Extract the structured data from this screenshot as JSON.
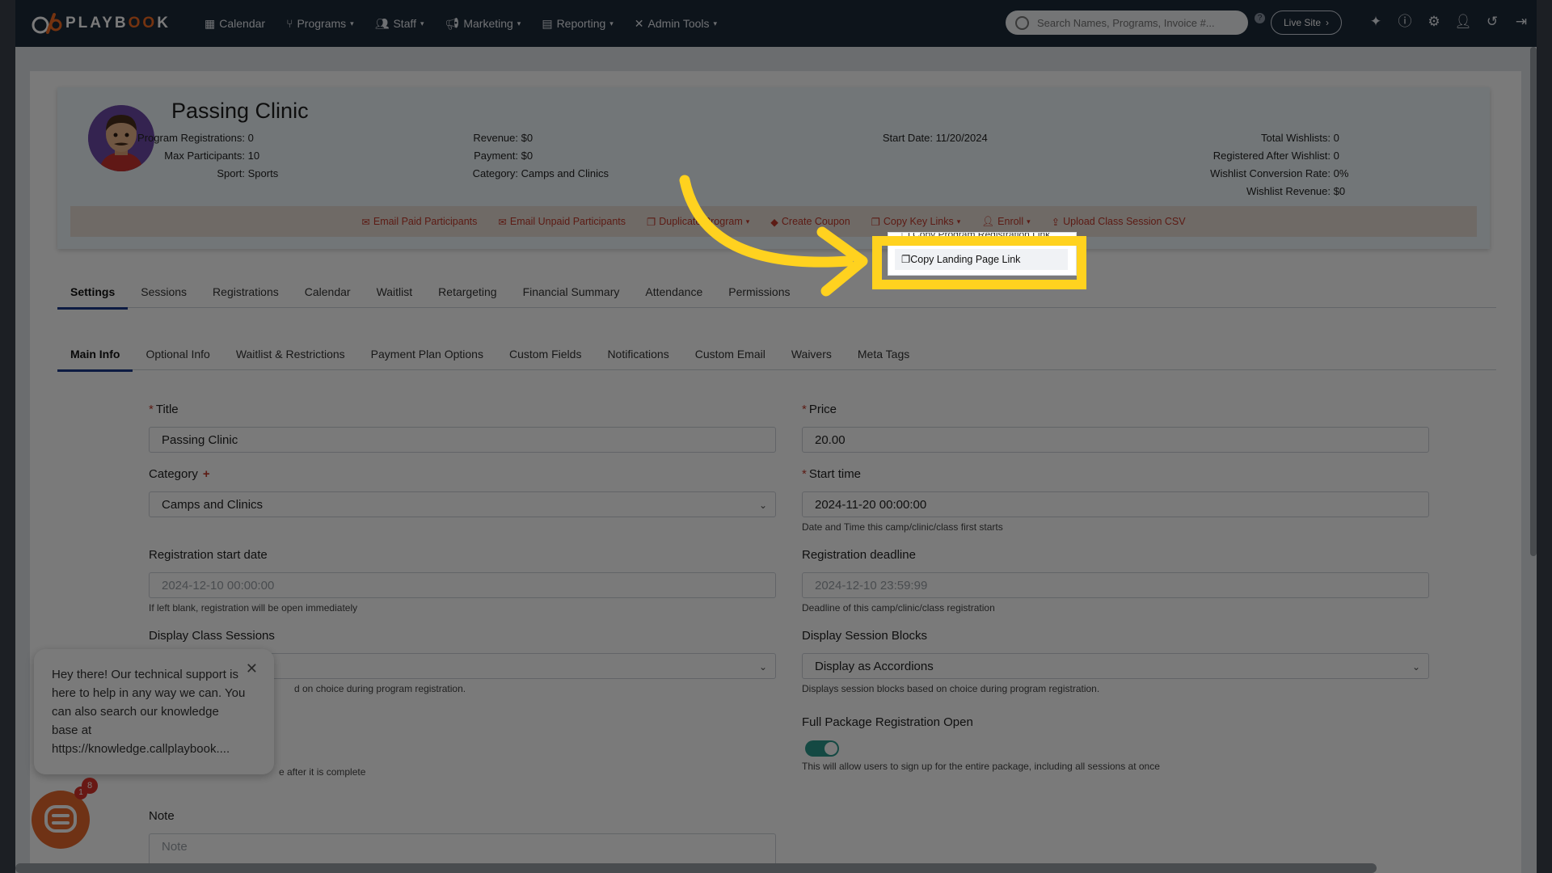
{
  "nav": {
    "brand": "PLAYBOOK",
    "items": [
      {
        "label": "Calendar",
        "icon": "calendar-icon",
        "caret": false
      },
      {
        "label": "Programs",
        "icon": "programs-icon",
        "caret": true
      },
      {
        "label": "Staff",
        "icon": "staff-icon",
        "caret": true
      },
      {
        "label": "Marketing",
        "icon": "megaphone-icon",
        "caret": true
      },
      {
        "label": "Reporting",
        "icon": "report-icon",
        "caret": true
      },
      {
        "label": "Admin Tools",
        "icon": "tools-icon",
        "caret": true
      }
    ],
    "search_placeholder": "Search Names, Programs, Invoice #...",
    "live_site": "Live Site"
  },
  "program": {
    "title": "Passing Clinic",
    "stats": {
      "program_registrations": {
        "label": "Program Registrations:",
        "value": "0"
      },
      "max_participants": {
        "label": "Max Participants:",
        "value": "10"
      },
      "sport": {
        "label": "Sport:",
        "value": "Sports"
      },
      "revenue": {
        "label": "Revenue:",
        "value": "$0"
      },
      "payment": {
        "label": "Payment:",
        "value": "$0"
      },
      "category": {
        "label": "Category:",
        "value": "Camps and Clinics"
      },
      "start_date": {
        "label": "Start Date:",
        "value": "11/20/2024"
      },
      "total_wishlists": {
        "label": "Total Wishlists:",
        "value": "0"
      },
      "registered_after_wishlist": {
        "label": "Registered After Wishlist:",
        "value": "0"
      },
      "wishlist_conversion_rate": {
        "label": "Wishlist Conversion Rate:",
        "value": "0%"
      },
      "wishlist_revenue": {
        "label": "Wishlist Revenue:",
        "value": "$0"
      }
    },
    "actions": {
      "email_paid": "Email Paid Participants",
      "email_unpaid": "Email Unpaid Participants",
      "duplicate": "Duplicate Program",
      "create_coupon": "Create Coupon",
      "copy_key_links": "Copy Key Links",
      "enroll": "Enroll",
      "upload_csv": "Upload Class Session CSV"
    },
    "dropdown": {
      "item1": "Copy Program Registration Link",
      "item2": "Copy Landing Page Link"
    }
  },
  "tabs": [
    "Settings",
    "Sessions",
    "Registrations",
    "Calendar",
    "Waitlist",
    "Retargeting",
    "Financial Summary",
    "Attendance",
    "Permissions"
  ],
  "subtabs": [
    "Main Info",
    "Optional Info",
    "Waitlist & Restrictions",
    "Payment Plan Options",
    "Custom Fields",
    "Notifications",
    "Custom Email",
    "Waivers",
    "Meta Tags"
  ],
  "form": {
    "title_label": "Title",
    "title_value": "Passing Clinic",
    "price_label": "Price",
    "price_value": "20.00",
    "category_label": "Category",
    "category_value": "Camps and Clinics",
    "start_time_label": "Start time",
    "start_time_value": "2024-11-20 00:00:00",
    "start_time_help": "Date and Time this camp/clinic/class first starts",
    "reg_start_label": "Registration start date",
    "reg_start_placeholder": "2024-12-10 00:00:00",
    "reg_start_help": "If left blank, registration will be open immediately",
    "reg_deadline_label": "Registration deadline",
    "reg_deadline_placeholder": "2024-12-10 23:59:99",
    "reg_deadline_help": "Deadline of this camp/clinic/class registration",
    "display_class_label": "Display Class Sessions",
    "display_class_help_partial": "d on choice during program registration.",
    "display_blocks_label": "Display Session Blocks",
    "display_blocks_value": "Display as Accordions",
    "display_blocks_help": "Displays session blocks based on choice during program registration.",
    "full_package_label": "Full Package Registration Open",
    "full_package_help": "This will allow users to sign up for the entire package, including all sessions at once",
    "complete_help_partial": "e after it is complete",
    "note_label": "Note",
    "note_placeholder": "Note"
  },
  "chat": {
    "message": "Hey there! Our technical support is here to help in any way we can. You can also search our knowledge base at https://knowledge.callplaybook....",
    "badge1": "8",
    "badge2": "1"
  },
  "colors": {
    "accent": "#ffd21f",
    "nav_bg": "#1d2a3a",
    "action_red": "#c0392b",
    "brand_orange": "#f26b22"
  }
}
